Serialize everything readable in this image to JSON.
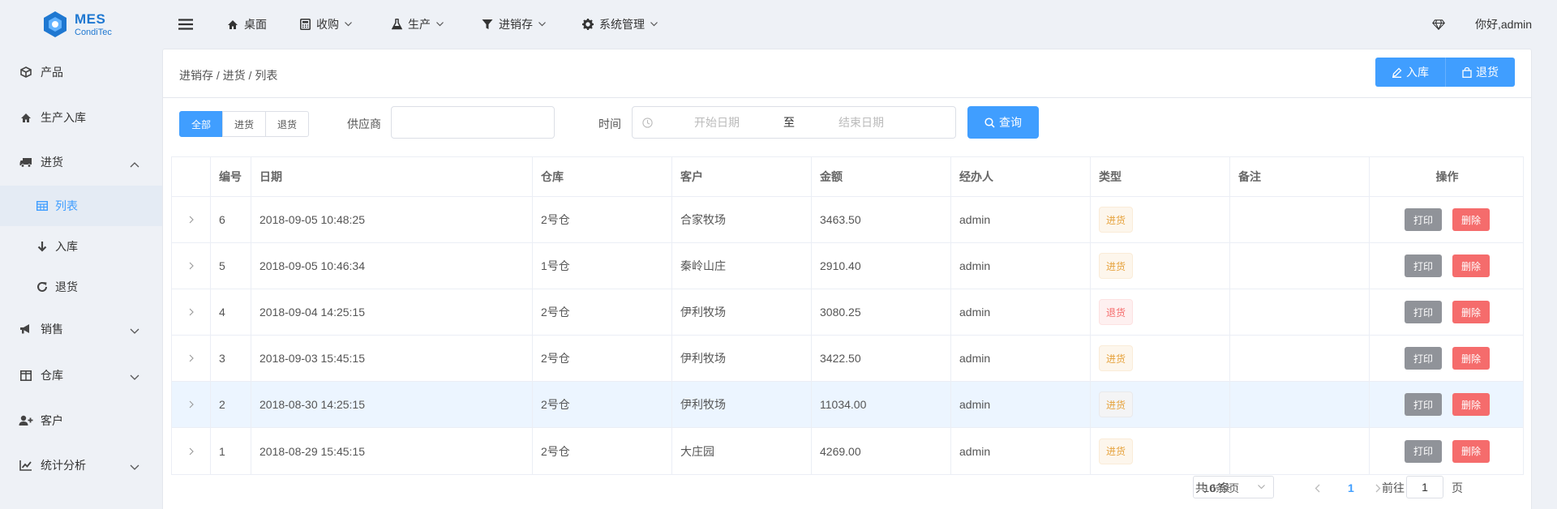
{
  "app": {
    "logo_title": "MES",
    "logo_subtitle": "CondiTec"
  },
  "header": {
    "menu_items": [
      "桌面",
      "收购",
      "生产",
      "进销存",
      "系统管理"
    ],
    "user_greeting": "你好,admin"
  },
  "sidebar": {
    "items": [
      {
        "label": "产品",
        "icon": "cube-icon"
      },
      {
        "label": "生产入库",
        "icon": "home-icon"
      },
      {
        "label": "进货",
        "icon": "truck-icon",
        "expanded": true
      },
      {
        "label": "列表",
        "icon": "table-icon",
        "sub": true,
        "active": true
      },
      {
        "label": "入库",
        "icon": "arrow-down-icon",
        "sub": true
      },
      {
        "label": "退货",
        "icon": "refresh-icon",
        "sub": true
      },
      {
        "label": "销售",
        "icon": "bullhorn-icon"
      },
      {
        "label": "仓库",
        "icon": "columns-icon"
      },
      {
        "label": "客户",
        "icon": "user-plus-icon"
      },
      {
        "label": "统计分析",
        "icon": "line-chart-icon"
      }
    ]
  },
  "page": {
    "breadcrumb": "进销存 / 进货 / 列表",
    "btn_stock_in": "入库",
    "btn_return": "退货"
  },
  "filters": {
    "type_options": [
      "全部",
      "进货",
      "退货"
    ],
    "type_selected": "全部",
    "supplier_label": "供应商",
    "supplier_value": "",
    "time_label": "时间",
    "start_placeholder": "开始日期",
    "range_separator": "至",
    "end_placeholder": "结束日期",
    "search_label": "查询"
  },
  "table": {
    "columns": [
      "编号",
      "日期",
      "仓库",
      "客户",
      "金额",
      "经办人",
      "类型",
      "备注",
      "操作"
    ],
    "rows": [
      {
        "id": "6",
        "date": "2018-09-05 10:48:25",
        "warehouse": "2号仓",
        "customer": "合家牧场",
        "amount": "3463.50",
        "handler": "admin",
        "type": "进货",
        "note": ""
      },
      {
        "id": "5",
        "date": "2018-09-05 10:46:34",
        "warehouse": "1号仓",
        "customer": "秦岭山庄",
        "amount": "2910.40",
        "handler": "admin",
        "type": "进货",
        "note": ""
      },
      {
        "id": "4",
        "date": "2018-09-04 14:25:15",
        "warehouse": "2号仓",
        "customer": "伊利牧场",
        "amount": "3080.25",
        "handler": "admin",
        "type": "退货",
        "note": ""
      },
      {
        "id": "3",
        "date": "2018-09-03 15:45:15",
        "warehouse": "2号仓",
        "customer": "伊利牧场",
        "amount": "3422.50",
        "handler": "admin",
        "type": "进货",
        "note": ""
      },
      {
        "id": "2",
        "date": "2018-08-30 14:25:15",
        "warehouse": "2号仓",
        "customer": "伊利牧场",
        "amount": "11034.00",
        "handler": "admin",
        "type": "进货",
        "note": ""
      },
      {
        "id": "1",
        "date": "2018-08-29 15:45:15",
        "warehouse": "2号仓",
        "customer": "大庄园",
        "amount": "4269.00",
        "handler": "admin",
        "type": "进货",
        "note": ""
      }
    ],
    "action_print": "打印",
    "action_delete": "删除"
  },
  "pagination": {
    "total_text": "共 6 条",
    "page_size": "10条/页",
    "current_page": "1",
    "goto_label": "前往",
    "goto_value": "1",
    "page_suffix": "页"
  },
  "colors": {
    "primary": "#409eff",
    "danger": "#f56c6c",
    "warning": "#e6a23c",
    "info": "#909399"
  }
}
